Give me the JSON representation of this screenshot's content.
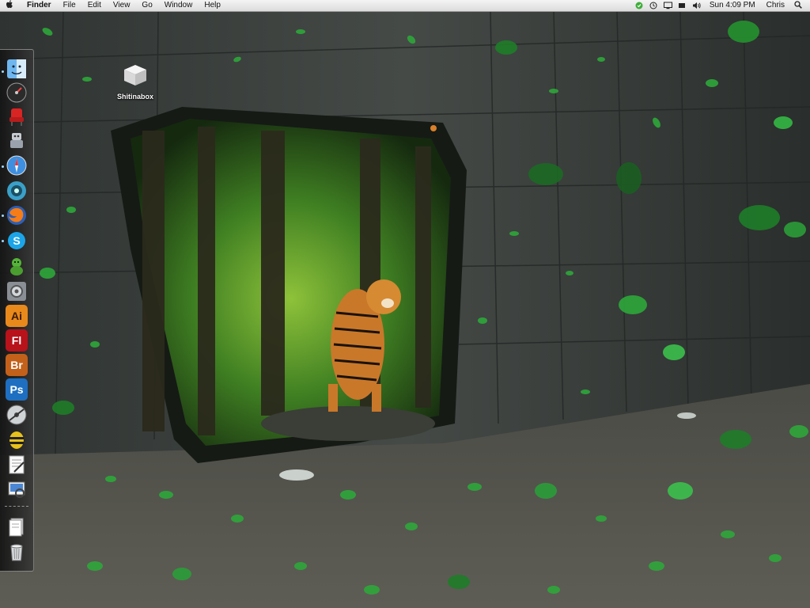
{
  "menubar": {
    "apple_icon": "apple-logo-icon",
    "app_name": "Finder",
    "menus": [
      "File",
      "Edit",
      "View",
      "Go",
      "Window",
      "Help"
    ],
    "status_icons": [
      "battery-green-icon",
      "time-machine-icon",
      "display-icon",
      "menu-extra-icon",
      "volume-icon"
    ],
    "clock": "Sun 4:09 PM",
    "user": "Chris",
    "search_icon": "spotlight-search-icon"
  },
  "desktop": {
    "icons": [
      {
        "label": "Shitinabox",
        "icon": "white-box-icon"
      }
    ]
  },
  "dock": {
    "position": "left",
    "items": [
      {
        "name": "finder",
        "icon": "finder-icon",
        "running": true
      },
      {
        "name": "dashboard",
        "icon": "dashboard-icon",
        "running": false
      },
      {
        "name": "chair-app",
        "icon": "red-chair-icon",
        "running": false
      },
      {
        "name": "automator",
        "icon": "automator-robot-icon",
        "running": false
      },
      {
        "name": "safari",
        "icon": "safari-compass-icon",
        "running": true
      },
      {
        "name": "dvd-player",
        "icon": "disc-player-icon",
        "running": false
      },
      {
        "name": "firefox",
        "icon": "firefox-icon",
        "running": true
      },
      {
        "name": "skype",
        "icon": "skype-icon",
        "running": true
      },
      {
        "name": "adium",
        "icon": "adium-duck-icon",
        "running": false
      },
      {
        "name": "system-preferences",
        "icon": "system-preferences-icon",
        "running": false
      },
      {
        "name": "illustrator",
        "icon": "illustrator-icon",
        "label": "Ai",
        "running": false
      },
      {
        "name": "flash",
        "icon": "flash-icon",
        "label": "Fl",
        "running": false
      },
      {
        "name": "bridge",
        "icon": "bridge-icon",
        "label": "Br",
        "running": false
      },
      {
        "name": "photoshop",
        "icon": "photoshop-icon",
        "label": "Ps",
        "running": false
      },
      {
        "name": "final-cut",
        "icon": "film-reel-icon",
        "running": false
      },
      {
        "name": "bee-app",
        "icon": "bee-icon",
        "running": false
      },
      {
        "name": "textedit",
        "icon": "textedit-icon",
        "running": false
      },
      {
        "name": "preview",
        "icon": "preview-icon",
        "running": false
      }
    ],
    "stack_items": [
      {
        "name": "documents-stack",
        "icon": "document-stack-icon"
      },
      {
        "name": "trash",
        "icon": "trash-icon"
      }
    ]
  },
  "colors": {
    "leaf_green": "#2ea83a",
    "wall_gray": "#3b403c",
    "menubar_bg": "#e8e8e8",
    "dock_bg": "#2a2a2a"
  }
}
